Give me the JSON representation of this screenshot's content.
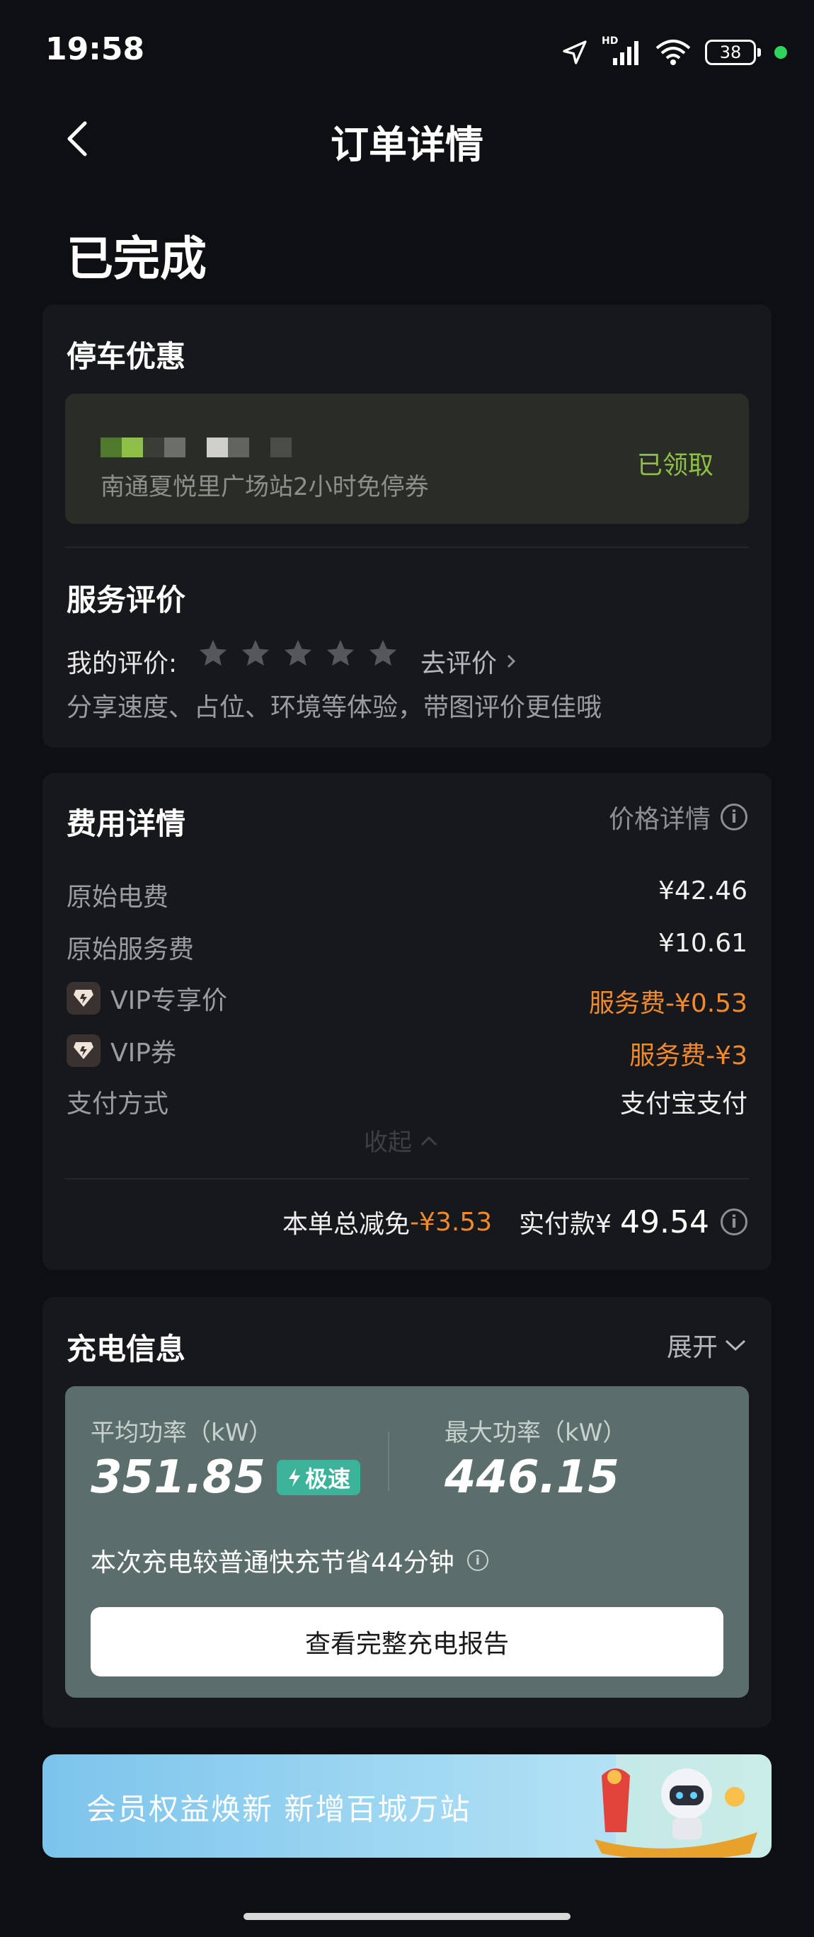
{
  "status_bar": {
    "time": "19:58",
    "hd": "HD",
    "battery": "38"
  },
  "header": {
    "title": "订单详情"
  },
  "order_status": "已完成",
  "parking": {
    "title": "停车优惠",
    "coupon_desc": "南通夏悦里广场站2小时免停券",
    "coupon_status": "已领取"
  },
  "review": {
    "title": "服务评价",
    "my_review_label": "我的评价:",
    "go_review": "去评价",
    "hint": "分享速度、占位、环境等体验，带图评价更佳哦"
  },
  "fees": {
    "title": "费用详情",
    "price_detail": "价格详情",
    "rows": [
      {
        "label": "原始电费",
        "value": "¥42.46"
      },
      {
        "label": "原始服务费",
        "value": "¥10.61"
      },
      {
        "label": "VIP专享价",
        "value": "服务费-¥0.53"
      },
      {
        "label": "VIP券",
        "value": "服务费-¥3"
      },
      {
        "label": "支付方式",
        "value": "支付宝支付"
      }
    ],
    "collapse": "收起",
    "total_discount_label": "本单总减免",
    "total_discount_value": "-¥3.53",
    "paid_label": "实付款¥",
    "paid_value": "49.54"
  },
  "charging": {
    "title": "充电信息",
    "expand": "展开",
    "avg_power_label": "平均功率（kW）",
    "avg_power_value": "351.85",
    "speed_tag": "极速",
    "max_power_label": "最大功率（kW）",
    "max_power_value": "446.15",
    "saving_text": "本次充电较普通快充节省44分钟",
    "report_button": "查看完整充电报告"
  },
  "banner": {
    "text": "会员权益焕新 新增百城万站"
  },
  "review_stars": 5,
  "colors": {
    "accent_orange": "#f08a2c",
    "claimed_green": "#8fbf47",
    "speed_tag": "#3bb399"
  }
}
